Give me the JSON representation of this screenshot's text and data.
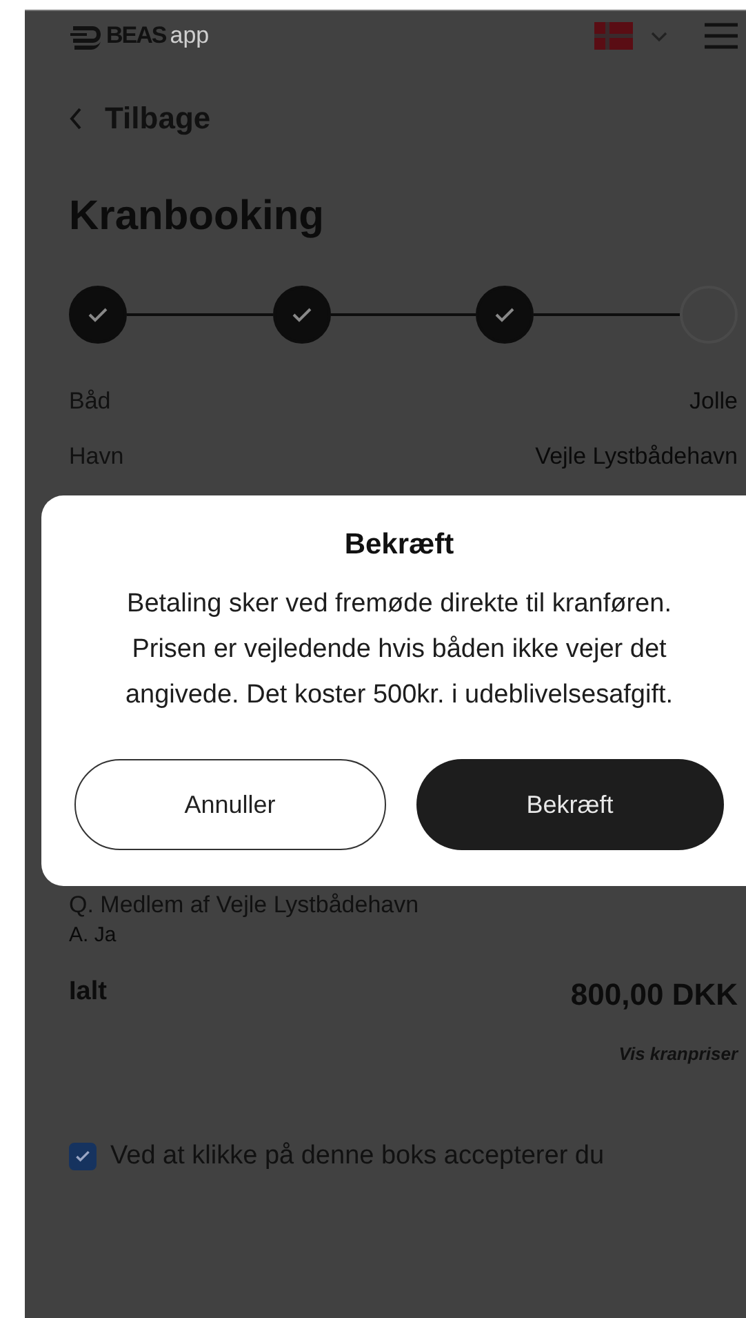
{
  "header": {
    "logo_text": "BEAS",
    "logo_suffix": "app"
  },
  "back_link": "Tilbage",
  "title": "Kranbooking",
  "steps": [
    {
      "completed": true
    },
    {
      "completed": true
    },
    {
      "completed": true
    },
    {
      "completed": false
    }
  ],
  "details": [
    {
      "label": "Båd",
      "value": "Jolle"
    },
    {
      "label": "Havn",
      "value": "Vejle Lystbådehavn"
    }
  ],
  "dialog": {
    "title": "Bekræft",
    "message": "Betaling sker ved fremøde direkte til kranføren. Prisen er vejledende hvis båden ikke vejer det angivede. Det koster 500kr. i udeblivelsesafgift.",
    "buttons": [
      {
        "label": "Annuller",
        "kind": "secondary"
      },
      {
        "label": "Bekræft",
        "kind": "primary"
      }
    ]
  },
  "question": {
    "question": "Q. Medlem af Vejle Lystbådehavn",
    "answer": "A. Ja"
  },
  "total": {
    "label": "Ialt",
    "value": "800,00 DKK"
  },
  "price_link": "Vis kranpriser",
  "terms": {
    "checked": true,
    "text": "Ved at klikke på denne boks accepterer du"
  }
}
